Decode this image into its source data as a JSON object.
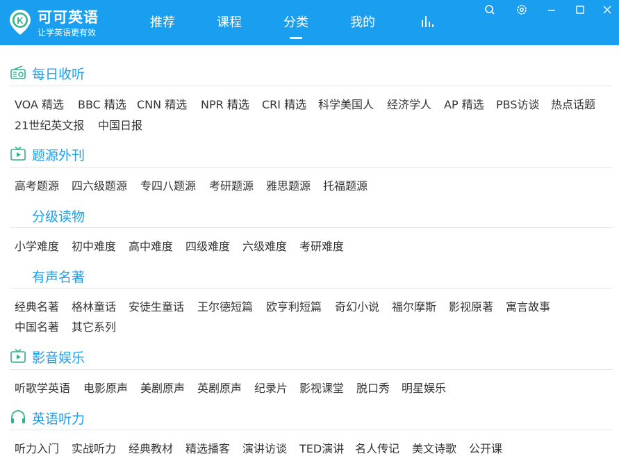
{
  "app": {
    "name": "可可英语",
    "slogan": "让学英语更有效",
    "logo_letter": "K"
  },
  "nav": {
    "tabs": [
      "推荐",
      "课程",
      "分类",
      "我的"
    ],
    "active": "分类"
  },
  "colors": {
    "brand": "#1a9ff0",
    "icon_green": "#2bb38a",
    "text": "#333333",
    "divider": "#e6e6e6"
  },
  "sections": [
    {
      "title": "每日收听",
      "icon": "radio-icon",
      "items": [
        "VOA 精选",
        "BBC 精选",
        "CNN 精选",
        "NPR 精选",
        "CRI 精选",
        "科学美国人",
        "经济学人",
        "AP 精选",
        "PBS访谈",
        "热点话题",
        "21世纪英文报",
        "中国日报"
      ]
    },
    {
      "title": "题源外刊",
      "icon": "tv-play-icon",
      "items": [
        "高考题源",
        "四六级题源",
        "专四八题源",
        "考研题源",
        "雅思题源",
        "托福题源"
      ]
    },
    {
      "title": "分级读物",
      "icon": "",
      "items": [
        "小学难度",
        "初中难度",
        "高中难度",
        "四级难度",
        "六级难度",
        "考研难度"
      ]
    },
    {
      "title": "有声名著",
      "icon": "",
      "items": [
        "经典名著",
        "格林童话",
        "安徒生童话",
        "王尔德短篇",
        "欧亨利短篇",
        "奇幻小说",
        "福尔摩斯",
        "影视原著",
        "寓言故事",
        "中国名著",
        "其它系列"
      ]
    },
    {
      "title": "影音娱乐",
      "icon": "tv-play-icon",
      "items": [
        "听歌学英语",
        "电影原声",
        "美剧原声",
        "英剧原声",
        "纪录片",
        "影视课堂",
        "脱口秀",
        "明星娱乐"
      ]
    },
    {
      "title": "英语听力",
      "icon": "headphones-icon",
      "items": [
        "听力入门",
        "实战听力",
        "经典教材",
        "精选播客",
        "演讲访谈",
        "TED演讲",
        "名人传记",
        "美文诗歌",
        "公开课"
      ]
    }
  ]
}
